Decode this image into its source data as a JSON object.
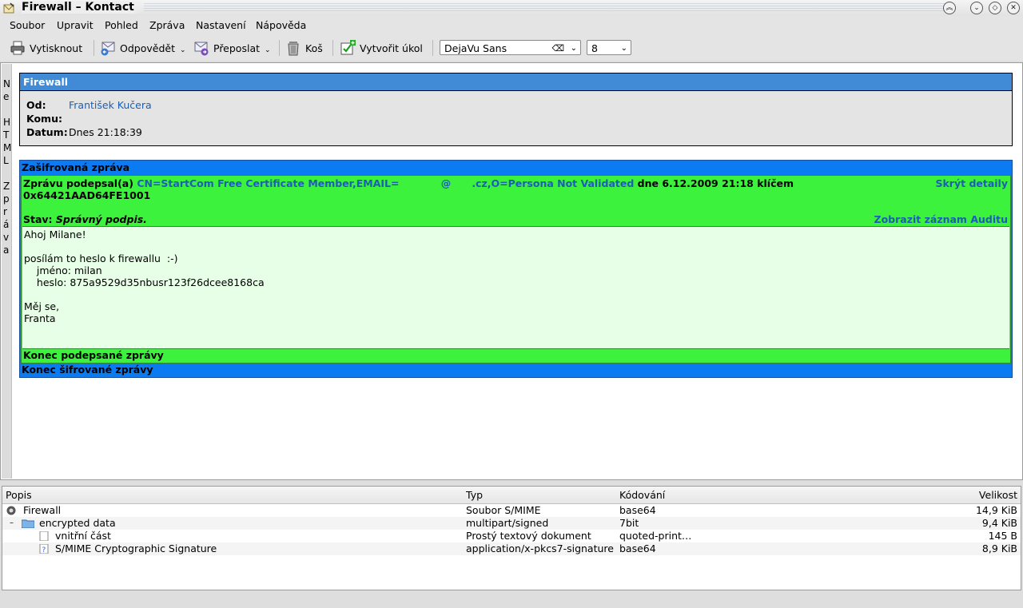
{
  "window": {
    "title": "Firewall – Kontact"
  },
  "menu": [
    "Soubor",
    "Upravit",
    "Pohled",
    "Zpráva",
    "Nastavení",
    "Nápověda"
  ],
  "toolbar": {
    "print": "Vytisknout",
    "reply": "Odpovědět",
    "forward": "Přeposlat",
    "trash": "Koš",
    "create_task": "Vytvořit úkol",
    "font_family": "DejaVu Sans",
    "font_size": "8"
  },
  "side_strip": [
    "N",
    "e",
    "",
    "H",
    "T",
    "M",
    "L",
    "",
    "Z",
    "p",
    "r",
    "á",
    "v",
    "a"
  ],
  "message": {
    "subject": "Firewall",
    "from_label": "Od:",
    "from": "František Kučera",
    "to_label": "Komu:",
    "to": "",
    "date_label": "Datum:",
    "date": "Dnes 21:18:39"
  },
  "security": {
    "encrypted_title": "Zašifrovaná zpráva",
    "signed_by_prefix": "Zprávu podepsal(a)",
    "signer": "CN=StartCom Free Certificate Member,EMAIL=            @      .cz,O=Persona Not Validated",
    "signed_date": "dne 6.12.2009 21:18 klíčem",
    "key_id": "0x64421AAD64FE1001",
    "hide_details": "Skrýt detaily",
    "status_label": "Stav:",
    "status_value": "Správný podpis.",
    "audit_link": "Zobrazit záznam Auditu",
    "signed_end": "Konec podepsané zprávy",
    "encrypted_end": "Konec šifrované zprávy"
  },
  "body_lines": [
    "Ahoj Milane!",
    "",
    "posílám to heslo k firewallu  :-)",
    "    jméno: milan",
    "    heslo: 875a9529d35nbusr123f26dcee8168ca",
    "",
    "Měj se,",
    "Franta"
  ],
  "parts": {
    "columns": [
      "Popis",
      "Typ",
      "Kódování",
      "Velikost"
    ],
    "rows": [
      {
        "name": "Firewall",
        "type": "Soubor S/MIME",
        "encoding": "base64",
        "size": "14,9 KiB",
        "icon": "smime-icon"
      },
      {
        "name": "encrypted data",
        "type": "multipart/signed",
        "encoding": "7bit",
        "size": "9,4 KiB",
        "icon": "folder-icon"
      },
      {
        "name": "vnitřní část",
        "type": "Prostý textový dokument",
        "encoding": "quoted-print…",
        "size": "145 B",
        "icon": "text-document-icon"
      },
      {
        "name": "S/MIME Cryptographic Signature",
        "type": "application/x-pkcs7-signature",
        "encoding": "base64",
        "size": "8,9 KiB",
        "icon": "unknown-file-icon"
      }
    ]
  },
  "colors": {
    "header_bar": "#418ad6",
    "encrypted_bar": "#0a7bf0",
    "signed_ok": "#3cf23c",
    "signed_body": "#e6ffe6",
    "link": "#1a5fb4"
  }
}
